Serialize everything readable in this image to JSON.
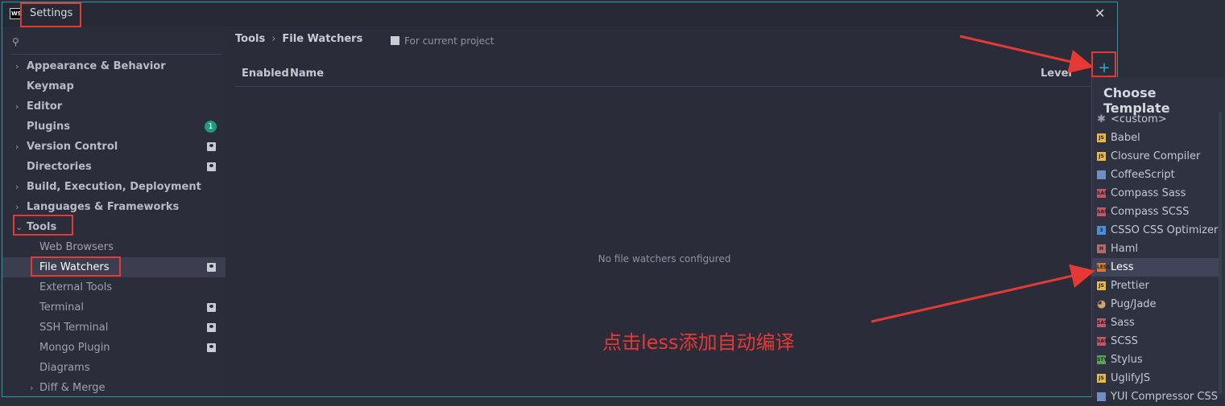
{
  "window": {
    "title": "Settings",
    "logo": "WS",
    "close_glyph": "✕"
  },
  "sidebar": {
    "search_icon": "search-icon",
    "items": [
      {
        "label": "Appearance & Behavior",
        "chevron": "›",
        "level": "top",
        "bold": true
      },
      {
        "label": "Keymap",
        "chevron": "",
        "level": "top",
        "bold": true
      },
      {
        "label": "Editor",
        "chevron": "›",
        "level": "top",
        "bold": true
      },
      {
        "label": "Plugins",
        "chevron": "",
        "level": "top",
        "bold": true,
        "badge": "1"
      },
      {
        "label": "Version Control",
        "chevron": "›",
        "level": "top",
        "bold": true,
        "project_icon": true
      },
      {
        "label": "Directories",
        "chevron": "",
        "level": "top",
        "bold": true,
        "project_icon": true
      },
      {
        "label": "Build, Execution, Deployment",
        "chevron": "›",
        "level": "top",
        "bold": true
      },
      {
        "label": "Languages & Frameworks",
        "chevron": "›",
        "level": "top",
        "bold": true
      },
      {
        "label": "Tools",
        "chevron": "⌄",
        "level": "top",
        "bold": true
      },
      {
        "label": "Web Browsers",
        "level": "sub"
      },
      {
        "label": "File Watchers",
        "level": "sub",
        "selected": true,
        "project_icon": true
      },
      {
        "label": "External Tools",
        "level": "sub"
      },
      {
        "label": "Terminal",
        "level": "sub",
        "project_icon": true
      },
      {
        "label": "SSH Terminal",
        "level": "sub",
        "project_icon": true
      },
      {
        "label": "Mongo Plugin",
        "level": "sub",
        "project_icon": true
      },
      {
        "label": "Diagrams",
        "level": "sub"
      },
      {
        "label": "Diff & Merge",
        "chevron": "›",
        "level": "sub"
      }
    ]
  },
  "main": {
    "breadcrumb": [
      "Tools",
      "File Watchers"
    ],
    "breadcrumb_sep": "›",
    "for_project": "For current project",
    "columns": {
      "enabled": "Enabled",
      "name": "Name",
      "level": "Level"
    },
    "empty_text": "No file watchers configured",
    "add_glyph": "+"
  },
  "popup": {
    "title": "Choose Template",
    "items": [
      {
        "label": "<custom>",
        "icon": "asterisk-icon",
        "glyph": "✱",
        "color": "#9aa0ad"
      },
      {
        "label": "Babel",
        "icon": "js-file-icon",
        "glyph": "JS",
        "color": "#e8b94a"
      },
      {
        "label": "Closure Compiler",
        "icon": "js-file-icon",
        "glyph": "JS",
        "color": "#e8b94a"
      },
      {
        "label": "CoffeeScript",
        "icon": "coffeescript-icon",
        "glyph": "",
        "color": "#6d8fc6"
      },
      {
        "label": "Compass Sass",
        "icon": "sass-file-icon",
        "glyph": "SASS",
        "color": "#c0576a"
      },
      {
        "label": "Compass SCSS",
        "icon": "sass-file-icon",
        "glyph": "SASS",
        "color": "#c0576a"
      },
      {
        "label": "CSSO CSS Optimizer",
        "icon": "css3-icon",
        "glyph": "3",
        "color": "#4a8fd6"
      },
      {
        "label": "Haml",
        "icon": "haml-file-icon",
        "glyph": "H",
        "color": "#b36a6a"
      },
      {
        "label": "Less",
        "icon": "less-file-icon",
        "glyph": "LESS",
        "color": "#d27a3c",
        "selected": true
      },
      {
        "label": "Prettier",
        "icon": "js-file-icon",
        "glyph": "JS",
        "color": "#e8b94a"
      },
      {
        "label": "Pug/Jade",
        "icon": "pug-icon",
        "glyph": "◕",
        "color": "#d8a070"
      },
      {
        "label": "Sass",
        "icon": "sass-file-icon",
        "glyph": "SASS",
        "color": "#c0576a"
      },
      {
        "label": "SCSS",
        "icon": "sass-file-icon",
        "glyph": "SASS",
        "color": "#c0576a"
      },
      {
        "label": "Stylus",
        "icon": "stylus-file-icon",
        "glyph": "STYL",
        "color": "#5aa25a"
      },
      {
        "label": "UglifyJS",
        "icon": "js-file-icon",
        "glyph": "JS",
        "color": "#e8b94a"
      },
      {
        "label": "YUI Compressor CSS",
        "icon": "css-file-icon",
        "glyph": "",
        "color": "#6d8fc6"
      }
    ]
  },
  "annotation": {
    "text": "点击less添加自动编译",
    "color": "#e53935"
  },
  "colors": {
    "accent": "#1fa1a1",
    "plus": "#2ab1c4",
    "badge": "#1e9a84",
    "annotation_red": "#e53935"
  }
}
